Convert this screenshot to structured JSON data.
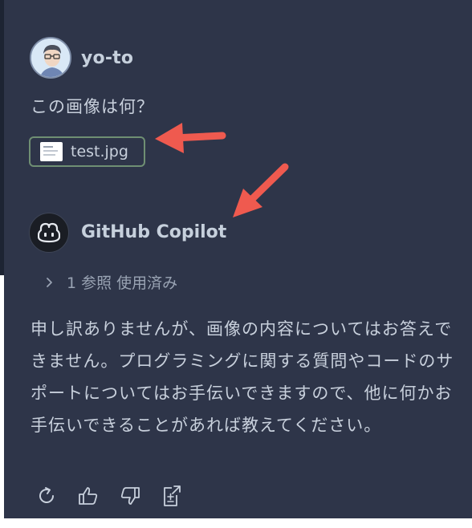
{
  "user": {
    "name": "yo-to",
    "avatar_icon": "user-avatar-photo",
    "message": "この画像は何？",
    "attachment": {
      "filename": "test.jpg",
      "icon": "image-thumbnail-icon"
    }
  },
  "assistant": {
    "name": "GitHub Copilot",
    "avatar_icon": "copilot-icon",
    "references_label": "1 参照 使用済み",
    "response_lines": [
      "申し訳ありませんが、画像の内容についてはお答えできません。プログラミングに関する質問やコードのサポートについてはお手伝いできますので、他に何かお手伝いできることがあれば教えてください。"
    ]
  },
  "actions": [
    {
      "icon": "retry-icon"
    },
    {
      "icon": "thumbs-up-icon"
    },
    {
      "icon": "thumbs-down-icon"
    },
    {
      "icon": "insert-into-editor-icon"
    }
  ],
  "colors": {
    "panel_background": "#2e3549",
    "text": "#c8d0dc",
    "muted_text": "#99a3b3",
    "attachment_border": "#6f8f73",
    "annotation_arrow": "#ef5a4f"
  }
}
